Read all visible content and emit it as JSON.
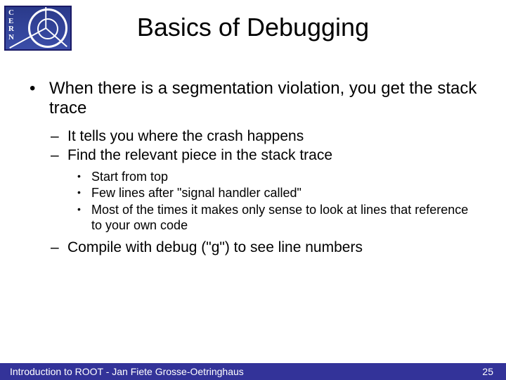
{
  "logo": {
    "org": "CERN"
  },
  "title": "Basics of Debugging",
  "bullets": {
    "b1": "When there is a segmentation violation, you get the stack trace",
    "b1_1": "It tells you where the crash happens",
    "b1_2": "Find the relevant piece in the stack trace",
    "b1_2_1": "Start from top",
    "b1_2_2": "Few lines after \"signal handler called\"",
    "b1_2_3": "Most of the times it makes only sense to look at lines that reference to your own code",
    "b1_3": "Compile with debug (\"g\") to see line numbers"
  },
  "footer": {
    "left": "Introduction to ROOT - Jan Fiete Grosse-Oetringhaus",
    "page": "25"
  }
}
